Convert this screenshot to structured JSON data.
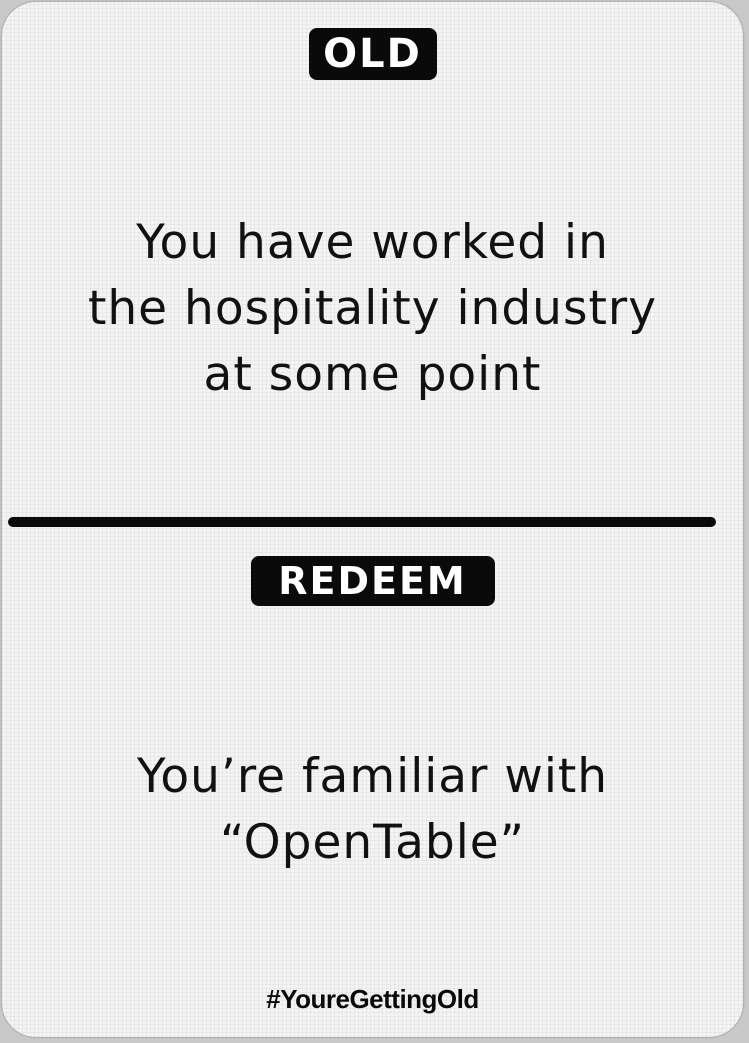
{
  "card": {
    "old_label": "OLD",
    "old_text_lines": [
      "You have worked in",
      "the hospitality industry",
      "at some point"
    ],
    "redeem_label": "REDEEM",
    "redeem_text_lines": [
      "You’re familiar with",
      "“OpenTable”"
    ],
    "hashtag": "#YoureGettingOld"
  },
  "colors": {
    "card_background": "#f4f4f4",
    "ink": "#0a0a0a",
    "badge_text": "#ffffff"
  }
}
